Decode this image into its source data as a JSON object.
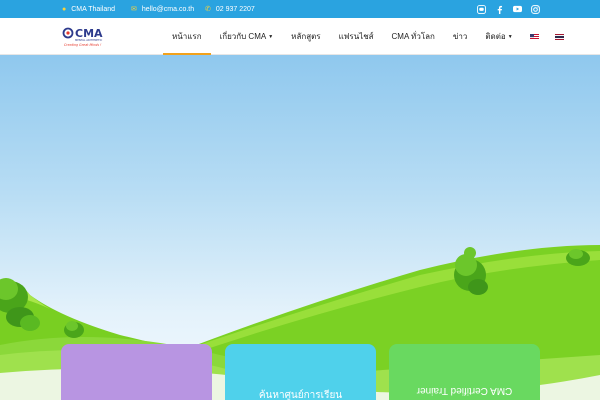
{
  "topbar": {
    "location": "CMA Thailand",
    "email": "hello@cma.co.th",
    "phone": "02 937 2207",
    "social": [
      "line-icon",
      "facebook-icon",
      "youtube-icon",
      "instagram-icon"
    ]
  },
  "logo": {
    "name": "CMA",
    "sub": "MENTAL ARITHMETIC",
    "tagline": "Creating Great Minds !"
  },
  "nav": {
    "items": [
      {
        "label": "หน้าแรก",
        "active": true,
        "dropdown": false
      },
      {
        "label": "เกี่ยวกับ CMA",
        "active": false,
        "dropdown": true
      },
      {
        "label": "หลักสูตร",
        "active": false,
        "dropdown": false
      },
      {
        "label": "แฟรนไชส์",
        "active": false,
        "dropdown": false
      },
      {
        "label": "CMA ทั่วโลก",
        "active": false,
        "dropdown": false
      },
      {
        "label": "ข่าว",
        "active": false,
        "dropdown": false
      },
      {
        "label": "ติดต่อ",
        "active": false,
        "dropdown": true
      }
    ],
    "languages": [
      "english-flag-icon",
      "thai-flag-icon"
    ]
  },
  "cards": [
    {
      "title": "",
      "color": "#b895e2"
    },
    {
      "title": "ค้นหาศูนย์การเรียน",
      "color": "#4fd1eb"
    },
    {
      "title": "CMA Certified Trainer",
      "color": "#69d960"
    }
  ],
  "colors": {
    "topbar": "#2aa3e0",
    "accent": "#f2a21b",
    "grass": "#7bd124"
  }
}
